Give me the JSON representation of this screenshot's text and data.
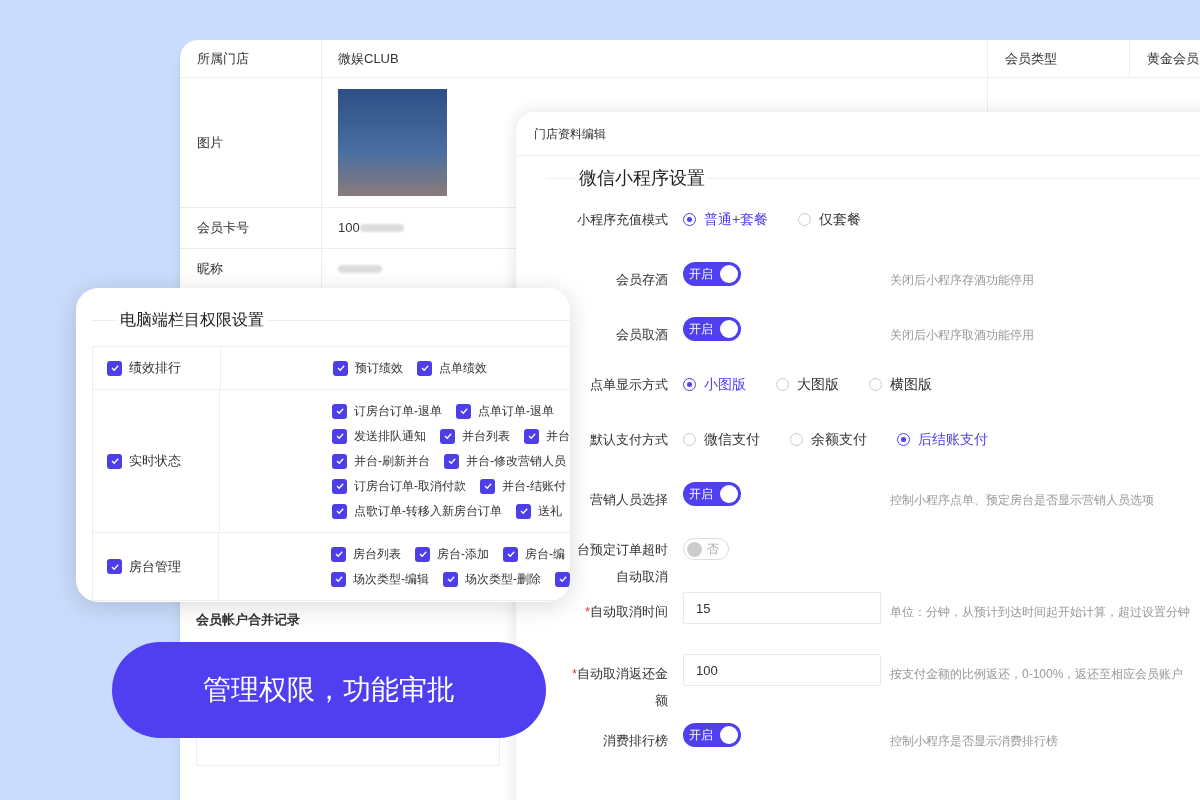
{
  "member_table": {
    "rows": [
      {
        "kind": "text",
        "label": "所属门店",
        "value": "微娱CLUB",
        "label_2": "会员类型",
        "value_2": "黄金会员"
      },
      {
        "kind": "image",
        "label": "图片"
      },
      {
        "kind": "text",
        "label": "会员卡号",
        "value": "100",
        "blurred": true
      },
      {
        "kind": "text",
        "label": "昵称",
        "value": "",
        "blurred": true
      }
    ],
    "section_title": "会员帐户合并记录"
  },
  "store_editor": {
    "title": "门店资料编辑",
    "section_title": "微信小程序设置",
    "rows": [
      {
        "kind": "radio",
        "label": "小程序充值模式",
        "options": [
          {
            "label": "普通+套餐",
            "selected": true
          },
          {
            "label": "仅套餐",
            "selected": false
          }
        ]
      },
      {
        "kind": "toggle",
        "label": "会员存酒",
        "on": true,
        "on_text": "开启",
        "hint": "关闭后小程序存酒功能停用"
      },
      {
        "kind": "toggle",
        "label": "会员取酒",
        "on": true,
        "on_text": "开启",
        "hint": "关闭后小程序取酒功能停用"
      },
      {
        "kind": "radio",
        "label": "点单显示方式",
        "options": [
          {
            "label": "小图版",
            "selected": true
          },
          {
            "label": "大图版",
            "selected": false
          },
          {
            "label": "横图版",
            "selected": false
          }
        ]
      },
      {
        "kind": "radio",
        "label": "默认支付方式",
        "options": [
          {
            "label": "微信支付",
            "selected": false
          },
          {
            "label": "余额支付",
            "selected": false
          },
          {
            "label": "后结账支付",
            "selected": true
          }
        ]
      },
      {
        "kind": "toggle",
        "label": "营销人员选择",
        "on": true,
        "on_text": "开启",
        "hint": "控制小程序点单、预定房台是否显示营销人员选项"
      },
      {
        "kind": "toggle",
        "label": "台预定订单超时自动取消",
        "on": false,
        "off_text": "否"
      },
      {
        "kind": "input",
        "label": "自动取消时间",
        "required_mark": "*",
        "value": "15",
        "hint": "单位：分钟，从预计到达时间起开始计算，超过设置分钟"
      },
      {
        "kind": "input",
        "label": "自动取消返还金额",
        "required_mark": "*",
        "value": "100",
        "hint": "按支付金额的比例返还，0-100%，返还至相应会员账户"
      },
      {
        "kind": "toggle",
        "label": "消费排行榜",
        "on": true,
        "on_text": "开启",
        "hint": "控制小程序是否显示消费排行榜"
      }
    ]
  },
  "permission_card": {
    "title": "电脑端栏目权限设置",
    "rows": [
      {
        "label": "绩效排行",
        "checked": true,
        "lines": [
          [
            {
              "label": "预订绩效",
              "checked": true
            },
            {
              "label": "点单绩效",
              "checked": true
            }
          ]
        ]
      },
      {
        "label": "实时状态",
        "checked": true,
        "lines": [
          [
            {
              "label": "订房台订单-退单",
              "checked": true
            },
            {
              "label": "点单订单-退单",
              "checked": true
            }
          ],
          [
            {
              "label": "发送排队通知",
              "checked": true
            },
            {
              "label": "并台列表",
              "checked": true
            },
            {
              "label": "并台",
              "checked": true
            }
          ],
          [
            {
              "label": "并台-刷新并台",
              "checked": true
            },
            {
              "label": "并台-修改营销人员",
              "checked": true
            }
          ],
          [
            {
              "label": "订房台订单-取消付款",
              "checked": true
            },
            {
              "label": "并台-结账付",
              "checked": true
            }
          ],
          [
            {
              "label": "点歌订单-转移入新房台订单",
              "checked": true
            },
            {
              "label": "送礼",
              "checked": true
            }
          ]
        ]
      },
      {
        "label": "房台管理",
        "checked": true,
        "lines": [
          [
            {
              "label": "房台列表",
              "checked": true
            },
            {
              "label": "房台-添加",
              "checked": true
            },
            {
              "label": "房台-编",
              "checked": true
            }
          ],
          [
            {
              "label": "场次类型-编辑",
              "checked": true
            },
            {
              "label": "场次类型-删除",
              "checked": true
            },
            {
              "checked": true
            }
          ]
        ]
      }
    ]
  },
  "banner": {
    "text": "管理权限，功能审批"
  }
}
